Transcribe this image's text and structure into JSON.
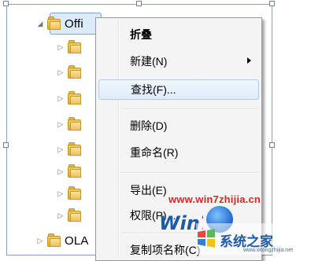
{
  "tree": {
    "selected_label": "Offi",
    "child_labels": [
      "",
      "",
      "",
      "",
      "",
      "",
      "",
      "",
      "",
      "",
      ""
    ],
    "sibling_label": "OLA"
  },
  "context_menu": {
    "items": [
      {
        "label": "折叠",
        "bold": true
      },
      {
        "label": "新建(N)",
        "submenu": true
      },
      {
        "label": "查找(F)...",
        "highlighted": true
      },
      {
        "label": "删除(D)"
      },
      {
        "label": "重命名(R)"
      },
      {
        "label": "导出(E)"
      },
      {
        "label": "权限(P)..."
      },
      {
        "label": "复制项名称(C)"
      }
    ]
  },
  "watermark": {
    "url": "www.win7zhijia.cn",
    "brand": "系统之家",
    "brand_small": "www.xitongzhijia.net",
    "logo_text": "Win7"
  },
  "colors": {
    "selection_fill": "#dcebfc",
    "selection_border": "#7da2ce",
    "menu_bg": "#f4f4f4",
    "watermark_red": "#e02424",
    "watermark_blue": "#1e5aa8"
  }
}
